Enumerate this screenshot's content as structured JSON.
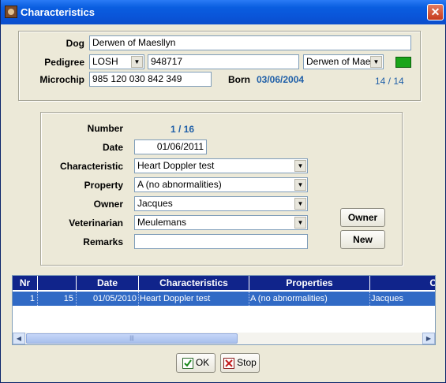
{
  "window": {
    "title": "Characteristics"
  },
  "dog": {
    "label": "Dog",
    "value": "Derwen of Maesllyn",
    "pedigree_label": "Pedigree",
    "pedigree_select": "LOSH",
    "pedigree_number": "948717",
    "pedigree_name": "Derwen of Mae",
    "microchip_label": "Microchip",
    "microchip_value": "985 120 030 842 349",
    "born_label": "Born",
    "born_value": "03/06/2004",
    "record_counter": "14 / 14"
  },
  "form": {
    "number_label": "Number",
    "number_value": "1 / 16",
    "date_label": "Date",
    "date_value": "01/06/2011",
    "characteristic_label": "Characteristic",
    "characteristic_value": "Heart Doppler test",
    "property_label": "Property",
    "property_value": "A (no abnormalities)",
    "owner_label": "Owner",
    "owner_value": "Jacques",
    "veterinarian_label": "Veterinarian",
    "veterinarian_value": "Meulemans",
    "remarks_label": "Remarks",
    "remarks_value": "",
    "owner_button": "Owner",
    "new_button": "New"
  },
  "grid": {
    "columns": [
      "Nr",
      "",
      "Date",
      "Characteristics",
      "Properties",
      "C"
    ],
    "rows": [
      {
        "nr": "1",
        "num": "15",
        "date": "01/05/2010",
        "characteristics": "Heart Doppler test",
        "properties": "A (no abnormalities)",
        "owner": "Jacques"
      }
    ]
  },
  "footer": {
    "ok_label": "OK",
    "stop_label": "Stop"
  },
  "colors": {
    "title_bar": "#0a54d8",
    "selection": "#316ac5",
    "header": "#10248b",
    "accent_text": "#1f5fa8",
    "status_green": "#1aa51a"
  }
}
